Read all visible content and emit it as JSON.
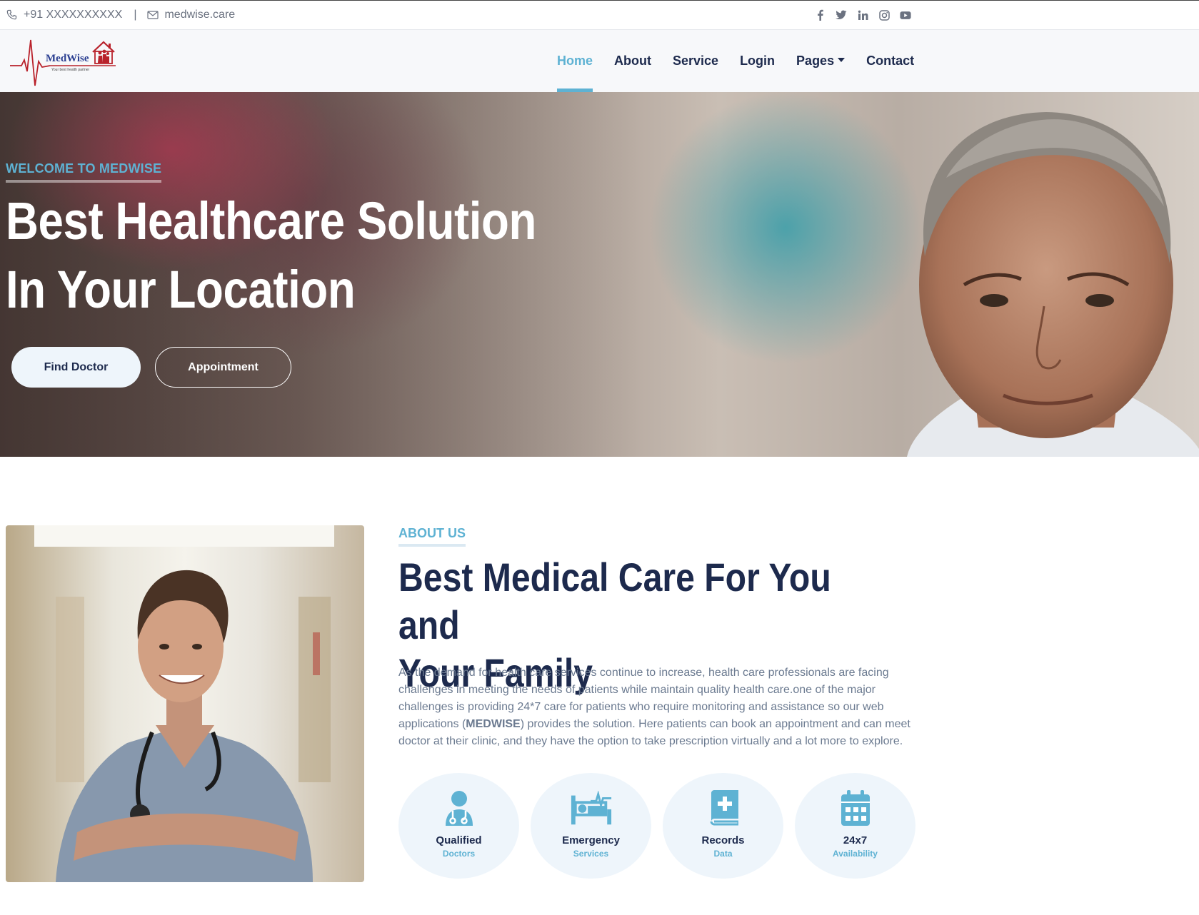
{
  "topbar": {
    "phone": "+91 XXXXXXXXXX",
    "separator": "|",
    "email": "medwise.care",
    "social": [
      "facebook-icon",
      "twitter-icon",
      "linkedin-icon",
      "instagram-icon",
      "youtube-icon"
    ]
  },
  "brand": {
    "name": "MedWise",
    "tagline": "Your best health partner"
  },
  "nav": {
    "items": [
      {
        "label": "Home",
        "active": true
      },
      {
        "label": "About"
      },
      {
        "label": "Service"
      },
      {
        "label": "Login"
      },
      {
        "label": "Pages",
        "dropdown": true
      },
      {
        "label": "Contact"
      }
    ]
  },
  "hero": {
    "kicker": "WELCOME TO MEDWISE",
    "title_line1": "Best Healthcare Solution",
    "title_line2": "In Your Location",
    "btn_find": "Find Doctor",
    "btn_appointment": "Appointment"
  },
  "about": {
    "kicker": "ABOUT US",
    "title_line1": "Best Medical Care For You and",
    "title_line2": "Your Family",
    "para_before": "As the demand for health care services continue to increase, health care professionals are facing challenges in meeting the needs of patients while maintain quality health care.one of the major challenges is providing 24*7 care for patients who require monitoring and assistance so our web applications (",
    "para_brand": "MEDWISE",
    "para_after": ") provides the solution. Here patients can book an appointment and can meet doctor at their clinic, and they have the option to take prescription virtually and a lot more to explore.",
    "features": [
      {
        "icon": "doctor-icon",
        "line1": "Qualified",
        "line2": "Doctors"
      },
      {
        "icon": "hospital-bed-icon",
        "line1": "Emergency",
        "line2": "Services"
      },
      {
        "icon": "medical-book-icon",
        "line1": "Records",
        "line2": "Data"
      },
      {
        "icon": "calendar-icon",
        "line1": "24x7",
        "line2": "Availability"
      }
    ]
  },
  "colors": {
    "accent": "#5eb2d3",
    "navy": "#1d2a4d",
    "muted": "#6b7a90",
    "light": "#eef5fb"
  }
}
